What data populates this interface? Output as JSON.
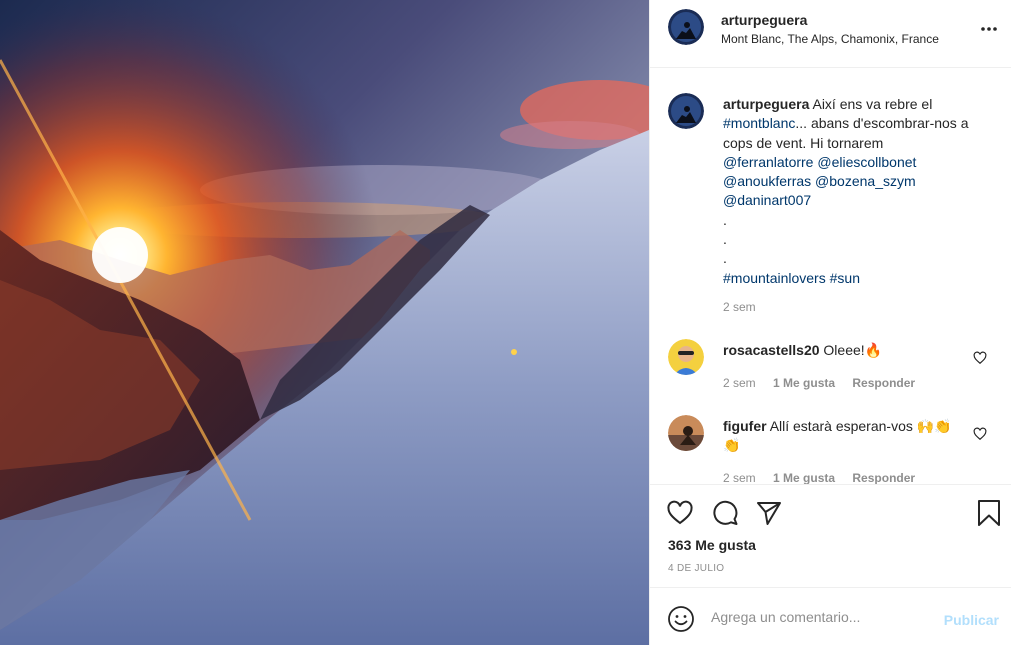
{
  "post": {
    "username": "arturpeguera",
    "location": "Mont Blanc, The Alps, Chamonix, France",
    "image_alt": "Sunset over snowy mountain ridge at Mont Blanc"
  },
  "caption": {
    "username": "arturpeguera",
    "text_start": "Així ens va rebre el",
    "line2_tag": "#montblanc",
    "line2_rest": "... abans d'escombrar-nos a cops de vent. Hi tornarem",
    "mentions_1a": "@ferranlatorre",
    "mentions_1b": "@eliescollbonet",
    "mentions_2a": "@anoukferras",
    "mentions_2b": "@bozena_szym",
    "mentions_3": "@daninart007",
    "dot1": ".",
    "dot2": ".",
    "dot3": ".",
    "hashtag_a": "#mountainlovers",
    "hashtag_b": "#sun",
    "time": "2 sem"
  },
  "comments": [
    {
      "username": "rosacastells20",
      "text": "Oleee!🔥",
      "time": "2 sem",
      "likes": "1 Me gusta",
      "reply": "Responder"
    },
    {
      "username": "figufer",
      "text": "Allí estarà esperan-vos 🙌👏👏",
      "time": "2 sem",
      "likes": "1 Me gusta",
      "reply": "Responder"
    }
  ],
  "actions": {
    "likes_count": "363 Me gusta",
    "date": "4 DE JULIO"
  },
  "add_comment": {
    "placeholder": "Agrega un comentario...",
    "publish_label": "Publicar"
  },
  "colors": {
    "accent_link": "#00376b",
    "publish_disabled": "#b2dffc",
    "secondary_text": "#8e8e8e"
  },
  "icons": [
    "more-icon",
    "heart-icon",
    "comment-icon",
    "share-icon",
    "bookmark-icon",
    "emoji-icon"
  ]
}
